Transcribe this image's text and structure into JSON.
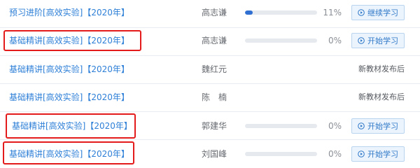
{
  "courses": [
    {
      "title": "预习进阶[高效实验]【2020年】",
      "teacher": "高志谦",
      "progress_percent": 11,
      "percent_label": "11%",
      "button_label": "继续学习",
      "status_text": null
    },
    {
      "title": "基础精讲[高效实验]【2020年】",
      "teacher": "高志谦",
      "progress_percent": 0,
      "percent_label": "0%",
      "button_label": "开始学习",
      "status_text": null
    },
    {
      "title": "基础精讲[高效实验]【2020年】",
      "teacher": "魏红元",
      "progress_percent": null,
      "percent_label": null,
      "button_label": null,
      "status_text": "新教材发布后"
    },
    {
      "title": "基础精讲[高效实验]【2020年】",
      "teacher": "陈　楠",
      "progress_percent": null,
      "percent_label": null,
      "button_label": null,
      "status_text": "新教材发布后"
    },
    {
      "title": "基础精讲[高效实验]【2020年】",
      "teacher": "郭建华",
      "progress_percent": 0,
      "percent_label": "0%",
      "button_label": "开始学习",
      "status_text": null
    },
    {
      "title": "基础精讲[高效实验]【2020年】",
      "teacher": "刘国峰",
      "progress_percent": 0,
      "percent_label": "0%",
      "button_label": "开始学习",
      "status_text": null
    }
  ],
  "colors": {
    "link": "#2d7fd7",
    "progress_fill": "#2f6fd1",
    "highlight": "#e31b1b",
    "button_bg": "#ebf4fd"
  },
  "icons": {
    "button_icon": "play-circle-icon"
  }
}
